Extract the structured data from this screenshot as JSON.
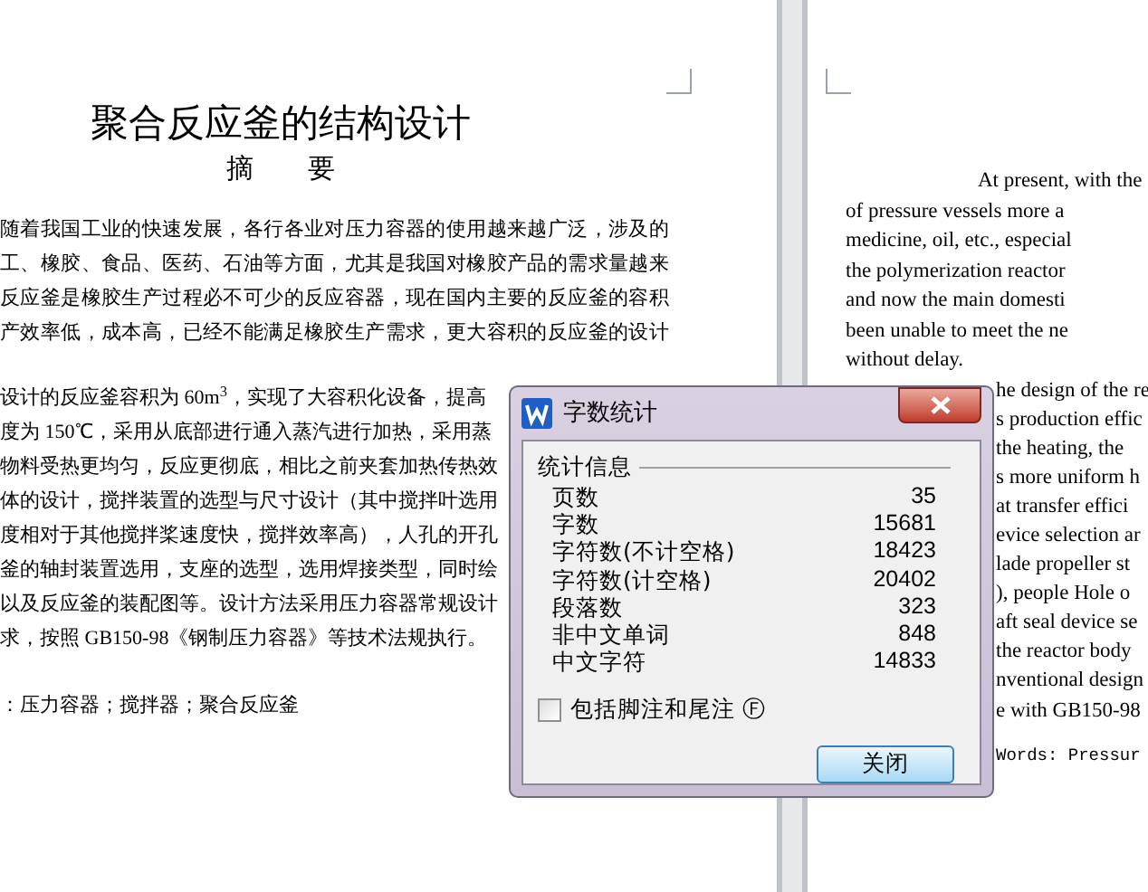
{
  "left_page": {
    "title": "聚合反应釜的结构设计",
    "heading": "摘　　要",
    "paragraph_1": [
      "随着我国工业的快速发展，各行各业对压力容器的使用越来越广泛，涉及的",
      "工、橡胶、食品、医药、石油等方面，尤其是我国对橡胶产品的需求量越来",
      "反应釜是橡胶生产过程必不可少的反应容器，现在国内主要的反应釜的容积",
      "产效率低，成本高，已经不能满足橡胶生产需求，更大容积的反应釜的设计"
    ],
    "paragraph_2": [
      "设计的反应釜容积为 60m$^{3}$，实现了大容积化设备，提高",
      "度为 150℃，采用从底部进行通入蒸汽进行加热，采用蒸",
      "物料受热更均匀，反应更彻底，相比之前夹套加热传热效",
      "体的设计，搅拌装置的选型与尺寸设计（其中搅拌叶选用",
      "度相对于其他搅拌桨速度快，搅拌效率高），人孔的开孔",
      "釜的轴封装置选用，支座的选型，选用焊接类型，同时绘",
      "以及反应釜的装配图等。设计方法采用压力容器常规设计",
      "求，按照 GB150-98《钢制压力容器》等技术法规执行。"
    ],
    "keywords": "：压力容器；搅拌器；聚合反应釜"
  },
  "right_page": {
    "lines": [
      "At present, with the",
      "of pressure vessels more a",
      "medicine, oil, etc., especial",
      "the polymerization reactor",
      "and now the main domesti",
      "been unable to meet the ne",
      "without delay."
    ],
    "lines_beside_dialog": [
      "he design of the re",
      "s production effic",
      "the heating, the",
      "s more uniform h",
      "at transfer effici",
      "evice selection ar",
      "lade propeller st",
      "), people Hole o",
      "aft seal device se",
      "the reactor body",
      "nventional design",
      "e with GB150-98"
    ],
    "keywords": "Words: Pressur"
  },
  "dialog": {
    "title": "字数统计",
    "group_label": "统计信息",
    "stats": [
      {
        "label": "页数",
        "value": "35"
      },
      {
        "label": "字数",
        "value": "15681"
      },
      {
        "label": "字符数(不计空格)",
        "value": "18423"
      },
      {
        "label": "字符数(计空格)",
        "value": "20402"
      },
      {
        "label": "段落数",
        "value": "323"
      },
      {
        "label": "非中文单词",
        "value": "848"
      },
      {
        "label": "中文字符",
        "value": "14833"
      }
    ],
    "checkbox": {
      "label": "包括脚注和尾注",
      "shortcut": "Ⓕ",
      "checked": false
    },
    "close_button": "关闭"
  }
}
